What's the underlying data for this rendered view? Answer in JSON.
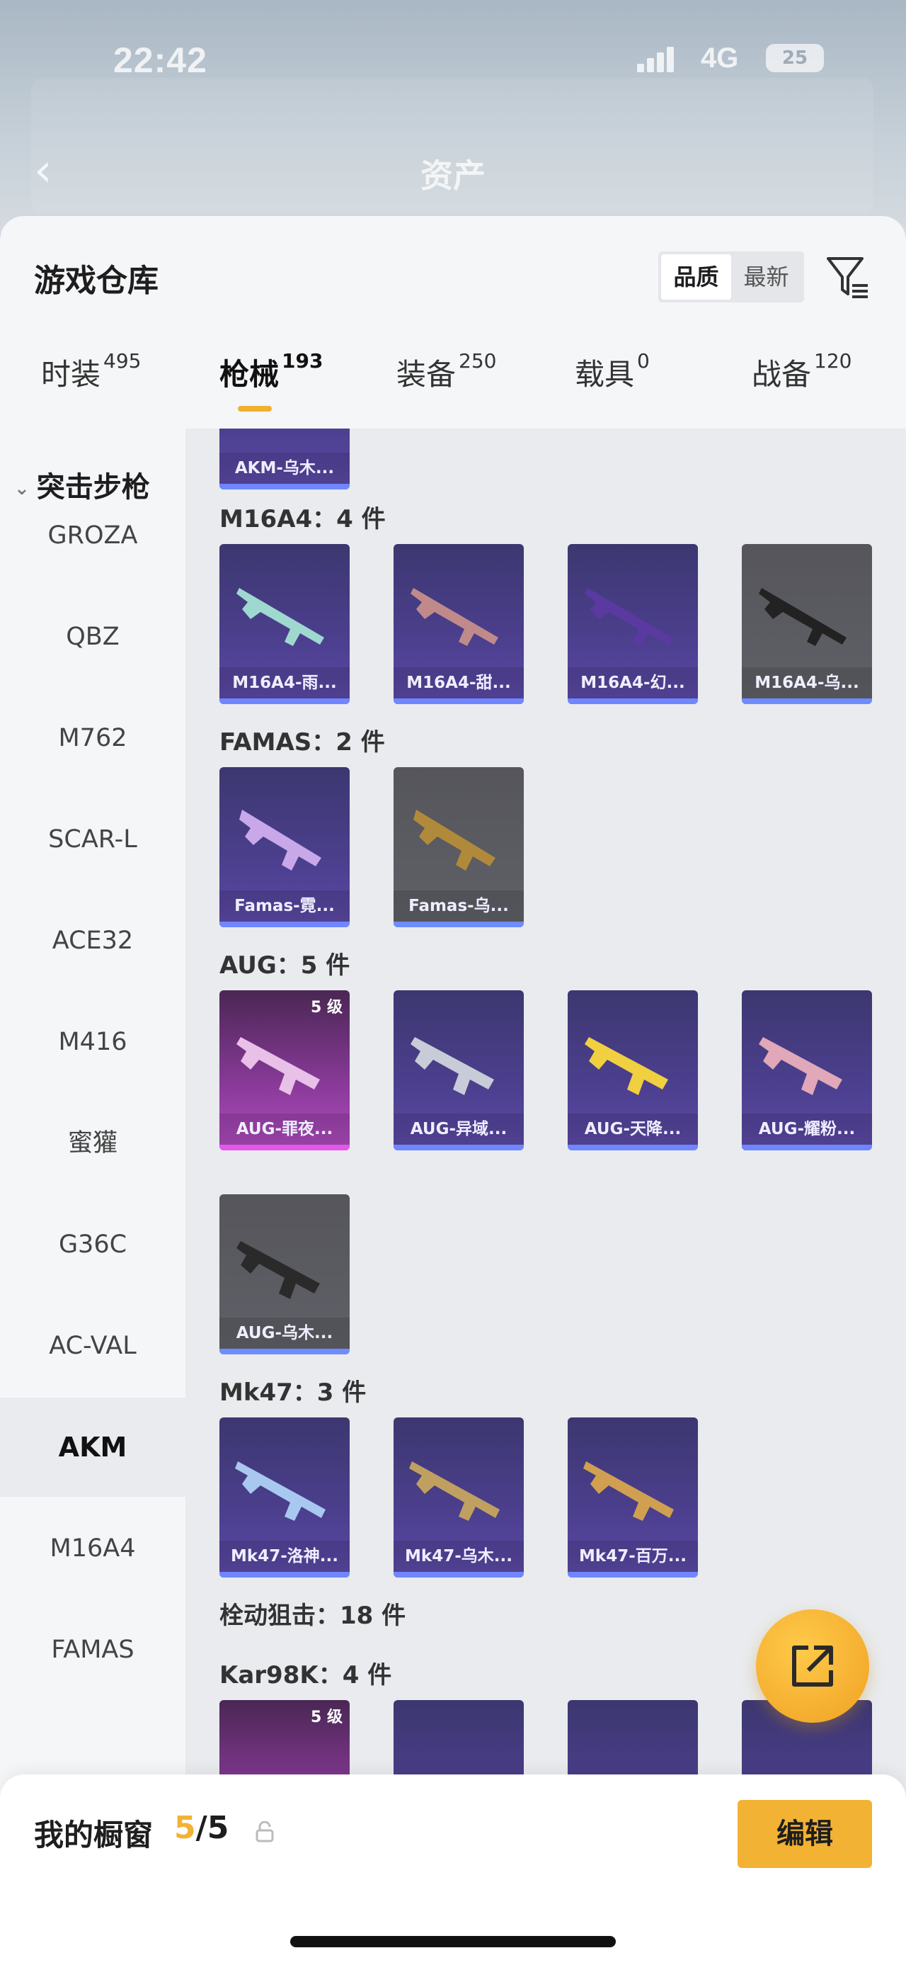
{
  "status_bar": {
    "time": "22:42",
    "network": "4G",
    "battery": "25"
  },
  "nav": {
    "title": "资产",
    "back_icon": "chevron-left-icon"
  },
  "header": {
    "title": "游戏仓库",
    "sort": {
      "options": [
        "品质",
        "最新"
      ],
      "selected": "品质"
    },
    "filter_icon": "filter-icon"
  },
  "tabs": [
    {
      "label": "时装",
      "count": "495"
    },
    {
      "label": "枪械",
      "count": "193",
      "active": true
    },
    {
      "label": "装备",
      "count": "250"
    },
    {
      "label": "载具",
      "count": "0"
    },
    {
      "label": "战备",
      "count": "120"
    }
  ],
  "sidemenu": {
    "group": "突击步枪",
    "items": [
      "GROZA",
      "QBZ",
      "M762",
      "SCAR-L",
      "ACE32",
      "M416",
      "蜜獾",
      "G36C",
      "AC-VAL",
      "AKM",
      "M16A4",
      "FAMAS"
    ],
    "active": "AKM"
  },
  "sections": [
    {
      "label": "",
      "cards": [
        {
          "name": "AKM-乌木...",
          "style": "purple"
        }
      ]
    },
    {
      "label": "M16A4：4 件",
      "cards": [
        {
          "name": "M16A4-雨...",
          "style": "purple"
        },
        {
          "name": "M16A4-甜...",
          "style": "purple"
        },
        {
          "name": "M16A4-幻...",
          "style": "purple"
        },
        {
          "name": "M16A4-乌...",
          "style": "grey"
        }
      ]
    },
    {
      "label": "FAMAS：2 件",
      "cards": [
        {
          "name": "Famas-霓...",
          "style": "purple"
        },
        {
          "name": "Famas-乌...",
          "style": "grey"
        }
      ]
    },
    {
      "label": "AUG：5 件",
      "cards": [
        {
          "name": "AUG-罪夜...",
          "style": "pink",
          "level": "5 级"
        },
        {
          "name": "AUG-异域...",
          "style": "purple"
        },
        {
          "name": "AUG-天降...",
          "style": "purple"
        },
        {
          "name": "AUG-耀粉...",
          "style": "purple"
        },
        {
          "name": "AUG-乌木...",
          "style": "grey"
        }
      ]
    },
    {
      "label": "Mk47：3 件",
      "cards": [
        {
          "name": "Mk47-洛神...",
          "style": "purple"
        },
        {
          "name": "Mk47-乌木...",
          "style": "purple"
        },
        {
          "name": "Mk47-百万...",
          "style": "purple"
        }
      ]
    },
    {
      "label": "栓动狙击：18 件",
      "cards": []
    },
    {
      "label": "Kar98K：4 件",
      "cards": [
        {
          "name": "",
          "style": "pink",
          "level": "5 级"
        },
        {
          "name": "",
          "style": "purple"
        },
        {
          "name": "",
          "style": "purple"
        },
        {
          "name": "",
          "style": "purple"
        }
      ]
    }
  ],
  "fab_icon": "share-icon",
  "showcase": {
    "label": "我的橱窗",
    "current": "5",
    "total": "/5",
    "lock_icon": "lock-icon",
    "edit": "编辑"
  },
  "colors": {
    "accent": "#f2b233",
    "purple_card": "#4c3f8e",
    "grey_card": "#5a5a60",
    "pink_card": "#b04cc0",
    "bar_blue": "#6f86ff"
  }
}
